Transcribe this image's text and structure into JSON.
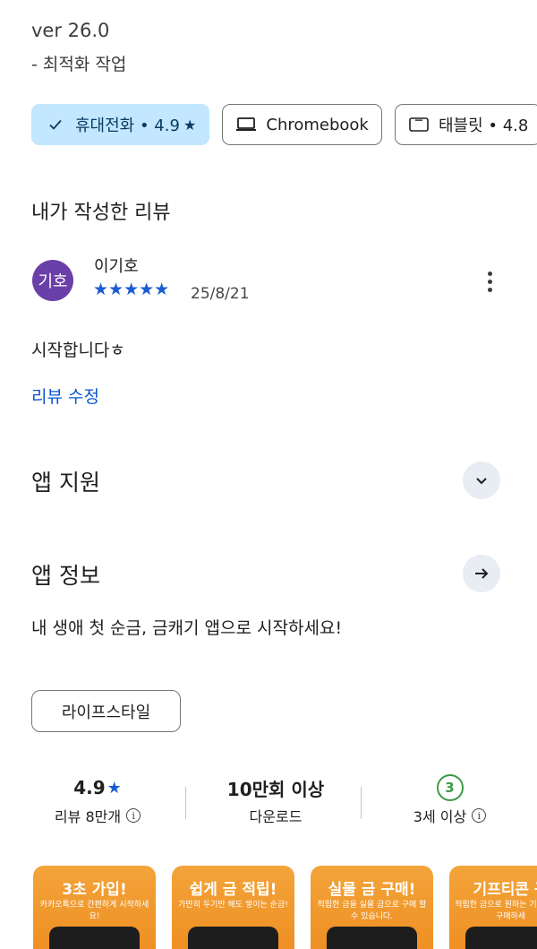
{
  "whats_new": {
    "version": "ver 26.0",
    "note": "- 최적화 작업"
  },
  "device_chips": [
    {
      "label": "휴대전화 • 4.9",
      "icon": "check-icon",
      "selected": true
    },
    {
      "label": "Chromebook",
      "icon": "laptop-icon",
      "selected": false
    },
    {
      "label": "태블릿 • 4.8",
      "icon": "tablet-icon",
      "selected": false
    }
  ],
  "my_review": {
    "section_title": "내가 작성한 리뷰",
    "avatar_text": "기호",
    "reviewer_name": "이기호",
    "stars": "★★★★★",
    "rating": 5,
    "date": "25/8/21",
    "text": "시작합니다ㅎ",
    "edit_label": "리뷰 수정"
  },
  "app_support": {
    "title": "앱 지원"
  },
  "app_info": {
    "title": "앱 정보",
    "description": "내 생애 첫 순금, 금캐기 앱으로 시작하세요!"
  },
  "category": {
    "label": "라이프스타일"
  },
  "stats": {
    "rating_value": "4.9",
    "rating_label": "리뷰 8만개",
    "downloads_value": "10만회 이상",
    "downloads_label": "다운로드",
    "age_badge": "3",
    "age_label": "3세 이상"
  },
  "screenshots": [
    {
      "title": "3초 가입!",
      "subtitle": "카카오톡으로 간편하게 시작하세요!"
    },
    {
      "title": "쉽게 금 적립!",
      "subtitle": "가만히 두기만 해도 쌓이는 순금!"
    },
    {
      "title": "실물 금 구매!",
      "subtitle": "적립한 금을 실물 금으로 구매 할 수 있습니다."
    },
    {
      "title": "기프티콘 구",
      "subtitle": "적립한 금으로 원하는 기프티콘을 구매하세"
    }
  ],
  "colors": {
    "selected_chip_bg": "#c2e7ff",
    "link_blue": "#0b57d0",
    "star_blue": "#1a5cd1",
    "avatar_purple": "#6b3fa8",
    "age_green": "#3c9a46",
    "screenshot_orange": "#f09a2d"
  }
}
